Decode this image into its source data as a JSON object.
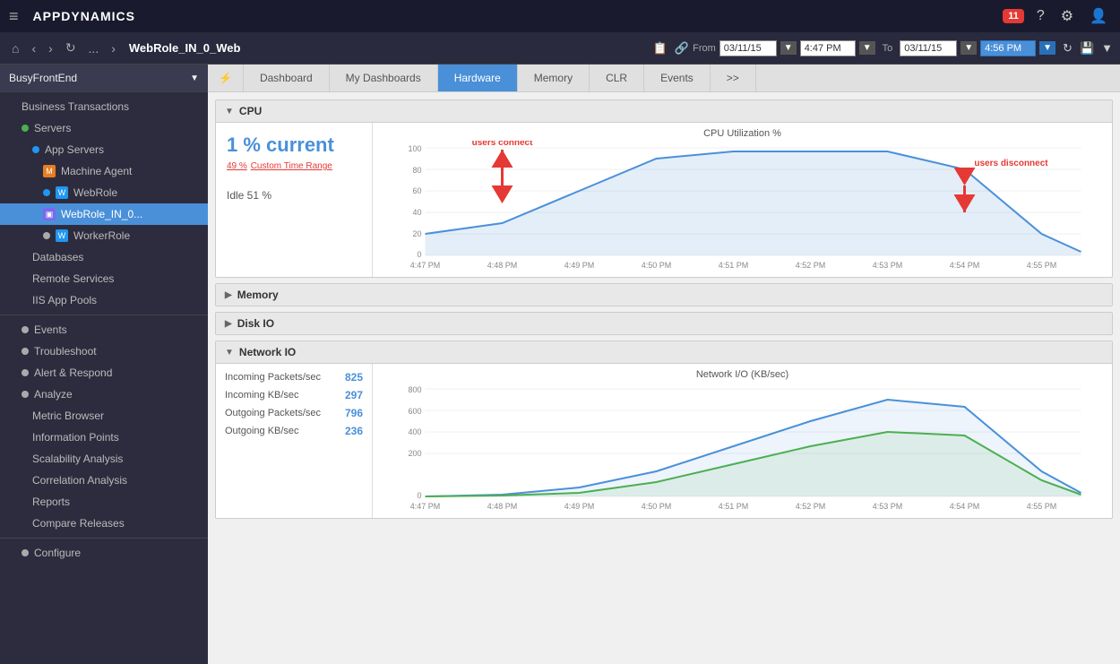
{
  "topbar": {
    "hamburger": "≡",
    "app_name": "APPDYNAMICS",
    "badge_count": "11",
    "help_icon": "?",
    "gear_icon": "⚙",
    "user_icon": "👤"
  },
  "navbar": {
    "home_icon": "⌂",
    "back_icon": "‹",
    "forward_icon": "›",
    "refresh_icon": "↻",
    "more_icon": "...",
    "chevron_icon": "›",
    "breadcrumb": "WebRole_IN_0_Web",
    "from_label": "From",
    "from_date": "03/11/15",
    "from_time": "4:47 PM",
    "to_label": "To",
    "to_date": "03/11/15",
    "to_time": "4:56 PM",
    "refresh_btn": "↻",
    "save_btn": "💾",
    "dropdown_btn": "▼"
  },
  "sidebar": {
    "current_app": "BusyFrontEnd",
    "items": [
      {
        "label": "Business Transactions",
        "level": 1,
        "type": "text"
      },
      {
        "label": "Servers",
        "level": 1,
        "type": "dot-green"
      },
      {
        "label": "App Servers",
        "level": 2,
        "type": "dot-blue"
      },
      {
        "label": "Machine Agent",
        "level": 3,
        "type": "icon-orange"
      },
      {
        "label": "WebRole",
        "level": 3,
        "type": "dot-blue"
      },
      {
        "label": "WebRole_IN_0...",
        "level": 4,
        "type": "icon-purple",
        "active": true
      },
      {
        "label": "WorkerRole",
        "level": 3,
        "type": "dot"
      },
      {
        "label": "Databases",
        "level": 2,
        "type": "text"
      },
      {
        "label": "Remote Services",
        "level": 2,
        "type": "text"
      },
      {
        "label": "IIS App Pools",
        "level": 2,
        "type": "text"
      },
      {
        "label": "Events",
        "level": 1,
        "type": "dot"
      },
      {
        "label": "Troubleshoot",
        "level": 1,
        "type": "dot"
      },
      {
        "label": "Alert & Respond",
        "level": 1,
        "type": "dot"
      },
      {
        "label": "Analyze",
        "level": 1,
        "type": "dot"
      },
      {
        "label": "Metric Browser",
        "level": 2,
        "type": "text"
      },
      {
        "label": "Information Points",
        "level": 2,
        "type": "text"
      },
      {
        "label": "Scalability Analysis",
        "level": 2,
        "type": "text"
      },
      {
        "label": "Correlation Analysis",
        "level": 2,
        "type": "text"
      },
      {
        "label": "Reports",
        "level": 2,
        "type": "text"
      },
      {
        "label": "Compare Releases",
        "level": 2,
        "type": "text"
      },
      {
        "label": "Configure",
        "level": 1,
        "type": "dot"
      }
    ]
  },
  "tabs": {
    "lightning": "⚡",
    "items": [
      {
        "label": "Dashboard",
        "active": false
      },
      {
        "label": "My Dashboards",
        "active": false
      },
      {
        "label": "Hardware",
        "active": true
      },
      {
        "label": "Memory",
        "active": false
      },
      {
        "label": "CLR",
        "active": false
      },
      {
        "label": "Events",
        "active": false
      },
      {
        "label": ">>",
        "active": false
      }
    ]
  },
  "cpu": {
    "section_title": "CPU",
    "current_label": "1 % current",
    "custom_label": "49 %",
    "custom_range_label": "Custom Time Range",
    "idle_label": "Idle 51 %",
    "chart_title": "CPU Utilization %",
    "y_axis": [
      100,
      80,
      60,
      40,
      20,
      0
    ],
    "x_axis": [
      "4:47 PM",
      "4:48 PM",
      "4:49 PM",
      "4:50 PM",
      "4:51 PM",
      "4:52 PM",
      "4:53 PM",
      "4:54 PM",
      "4:55 PM"
    ],
    "annotations": {
      "connect_label": "users connect",
      "disconnect_label": "users disconnect"
    }
  },
  "memory": {
    "section_title": "Memory"
  },
  "disk_io": {
    "section_title": "Disk IO"
  },
  "network_io": {
    "section_title": "Network  IO",
    "chart_title": "Network I/O (KB/sec)",
    "stats": [
      {
        "label": "Incoming Packets/sec",
        "value": "825"
      },
      {
        "label": "Incoming KB/sec",
        "value": "297"
      },
      {
        "label": "Outgoing Packets/sec",
        "value": "796"
      },
      {
        "label": "Outgoing KB/sec",
        "value": "236"
      }
    ],
    "y_axis": [
      800,
      600,
      400,
      200,
      0
    ],
    "x_axis": [
      "4:47 PM",
      "4:48 PM",
      "4:49 PM",
      "4:50 PM",
      "4:51 PM",
      "4:52 PM",
      "4:53 PM",
      "4:54 PM",
      "4:55 PM"
    ]
  }
}
